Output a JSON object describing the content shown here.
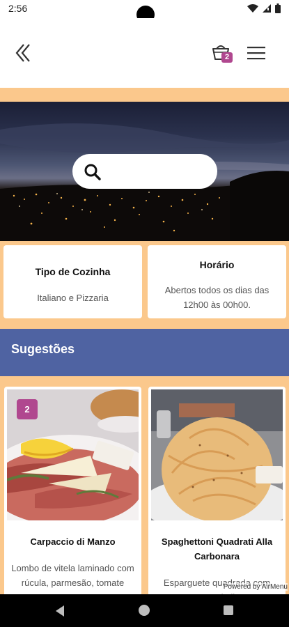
{
  "status_bar": {
    "time": "2:56",
    "icons": [
      "wifi-icon",
      "signal-icon",
      "battery-icon"
    ]
  },
  "header": {
    "back_icon": "double-chevron-left-icon",
    "cart_icon": "basket-icon",
    "cart_count": "2",
    "menu_icon": "hamburger-menu-icon"
  },
  "search": {
    "placeholder": "",
    "value": ""
  },
  "info": {
    "cuisine_title": "Tipo de Cozinha",
    "cuisine_value": "Italiano e Pizzaria",
    "hours_title": "Horário",
    "hours_value": "Abertos todos os dias das 12h00 às 00h00."
  },
  "suggestions": {
    "title": "Sugestões",
    "items": [
      {
        "name": "Carpaccio di Manzo",
        "description": "Lombo de vitela laminado com rúcula, parmesão, tomate",
        "quantity": "2"
      },
      {
        "name": "Spaghettoni Quadrati Alla Carbonara",
        "description": "Esparguete quadrada com pancetta italiana"
      }
    ]
  },
  "powered_by": "Powered by AirMenu",
  "colors": {
    "accent_orange": "#fbc88c",
    "section_blue": "#4f63a2",
    "badge_magenta": "#b0478f"
  }
}
